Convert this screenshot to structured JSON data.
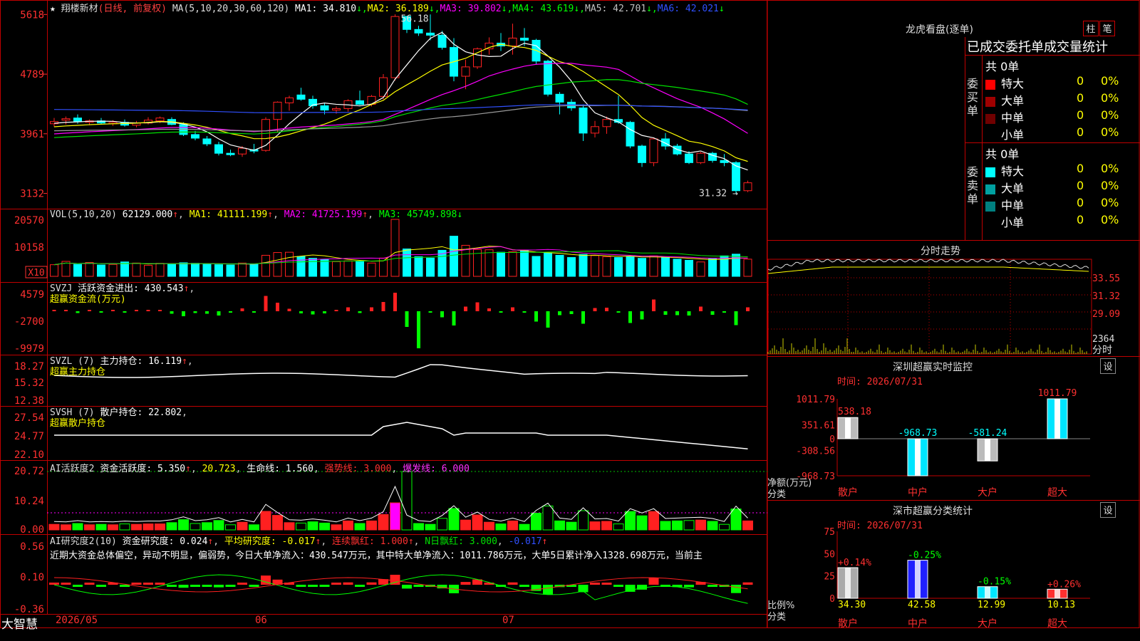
{
  "colors": {
    "up": "#ff2020",
    "down": "#00ffff",
    "grid": "#c00000",
    "white": "#ffffff",
    "yellow": "#ffff00",
    "magenta": "#ff00ff",
    "green": "#00e000",
    "gray": "#9a9a9a",
    "blue": "#3050ff",
    "lime": "#00ff00"
  },
  "header": {
    "stock_name": "翔楼新材",
    "mode": "(日线, 前复权)",
    "ma_params": "MA(5,10,20,30,60,120)",
    "mas": [
      {
        "label": "MA1: 34.810",
        "arrow": "↓",
        "color": "#ffffff"
      },
      {
        "label": "MA2: 36.189",
        "arrow": "↓",
        "color": "#ffff00"
      },
      {
        "label": "MA3: 39.802",
        "arrow": "↓",
        "color": "#ff00ff"
      },
      {
        "label": "MA4: 43.619",
        "arrow": "↓",
        "color": "#00ff00"
      },
      {
        "label": "MA5: 42.701",
        "arrow": "↓",
        "color": "#c0c0c0"
      },
      {
        "label": "MA6: 42.021",
        "arrow": "↓",
        "color": "#3050ff"
      }
    ]
  },
  "price_axis": [
    "5618",
    "4789",
    "3961",
    "3132"
  ],
  "annotations": {
    "high": "56.18",
    "low": "31.32"
  },
  "vol": {
    "title": "VOL(5,10,20)",
    "value": "62129.000",
    "ma1": "MA1: 41111.199",
    "ma2": "MA2: 41725.199",
    "ma3": "MA3: 45749.898",
    "axis": [
      "20570",
      "10158"
    ],
    "unit": "X10"
  },
  "svzj": {
    "title": "SVZJ",
    "label": "活跃资金进出: 430.543",
    "sub": "超赢资金流(万元)",
    "axis": [
      "4579",
      "-2700",
      "-9979"
    ]
  },
  "svzl": {
    "title": "SVZL (7)",
    "label": "主力持仓: 16.119",
    "sub": "超赢主力持仓",
    "axis": [
      "18.27",
      "15.32",
      "12.38"
    ]
  },
  "svsh": {
    "title": "SVSH (7)",
    "label": "散户持仓: 22.802",
    "sub": "超赢散户持仓",
    "axis": [
      "27.54",
      "24.77",
      "22.10"
    ]
  },
  "ai_active": {
    "title": "AI活跃度2",
    "label": "资金活跃度: 5.350",
    "v2": "20.723",
    "life": "生命线: 1.560",
    "strong": "强势线: 3.000",
    "burst": "爆发线: 6.000",
    "axis": [
      "20.72",
      "10.24",
      "0.00"
    ]
  },
  "ai_research": {
    "title": "AI研究度2(10)",
    "label": "资金研究度: 0.024",
    "avg": "平均研究度: -0.017",
    "red": "连续飘红: 1.000",
    "nday": "N日飘红: 3.000",
    "last": "-0.017",
    "axis": [
      "0.56",
      "0.10",
      "-0.36"
    ],
    "text": "近期大资金总体偏空，异动不明显，偏弱势，今日大单净流入：430.547万元，其中特大单净流入：1011.786万元，大单5日累计净入1328.698万元，当前主"
  },
  "date_axis": {
    "brand": "大智慧",
    "labels": [
      "2026/05",
      "06",
      "07"
    ]
  },
  "dragon": {
    "title": "龙虎看盘(逐单)",
    "btn1": "柱",
    "btn2": "笔",
    "tabs": "已成交委托单成交量统计",
    "buy_title": "委买单",
    "sell_title": "委卖单",
    "total_buy": "共 0单",
    "total_sell": "共 0单",
    "rows_buy": [
      {
        "name": "特大",
        "val": "0",
        "pct": "0%",
        "color": "#ff0000"
      },
      {
        "name": "大单",
        "val": "0",
        "pct": "0%",
        "color": "#a00000"
      },
      {
        "name": "中单",
        "val": "0",
        "pct": "0%",
        "color": "#700000"
      },
      {
        "name": "小单",
        "val": "0",
        "pct": "0%",
        "color": "#000000"
      }
    ],
    "rows_sell": [
      {
        "name": "特大",
        "val": "0",
        "pct": "0%",
        "color": "#00ffff"
      },
      {
        "name": "大单",
        "val": "0",
        "pct": "0%",
        "color": "#00a0a0"
      },
      {
        "name": "中单",
        "val": "0",
        "pct": "0%",
        "color": "#008080"
      },
      {
        "name": "小单",
        "val": "0",
        "pct": "0%",
        "color": "#000000"
      }
    ]
  },
  "intraday": {
    "title": "分时走势",
    "axis": [
      "33.55",
      "31.32",
      "29.09",
      "2364"
    ],
    "suffix": "分时"
  },
  "monitor": {
    "title": "深圳超赢实时监控",
    "set": "设",
    "time": "时间: 2026/07/31",
    "ylabel": "净额(万元)",
    "xlabel": "分类",
    "axis": [
      "1011.79",
      "351.61",
      "0",
      "-308.56",
      "-968.73"
    ],
    "bars": [
      {
        "name": "散户",
        "value": 538.18,
        "label": "538.18"
      },
      {
        "name": "中户",
        "value": -968.73,
        "label": "-968.73"
      },
      {
        "name": "大户",
        "value": -581.24,
        "label": "-581.24"
      },
      {
        "name": "超大",
        "value": 1011.79,
        "label": "1011.79"
      }
    ]
  },
  "classify": {
    "title": "深市超赢分类统计",
    "set": "设",
    "time": "时间: 2026/07/31",
    "ylabel": "比例%",
    "xlabel": "分类",
    "axis": [
      "75",
      "50",
      "25",
      "0"
    ],
    "bars": [
      {
        "name": "散户",
        "value": 34.3,
        "label": "34.30",
        "delta": "+0.14%"
      },
      {
        "name": "中户",
        "value": 42.58,
        "label": "42.58",
        "delta": "-0.25%"
      },
      {
        "name": "大户",
        "value": 12.99,
        "label": "12.99",
        "delta": "-0.15%"
      },
      {
        "name": "超大",
        "value": 10.13,
        "label": "10.13",
        "delta": "+0.26%"
      }
    ]
  },
  "chart_data": {
    "type": "candlestick",
    "title": "翔楼新材 (日线, 前复权)",
    "ylim": [
      31.32,
      56.18
    ],
    "ohlc": [
      [
        41.0,
        41.8,
        40.6,
        41.3
      ],
      [
        41.5,
        42.0,
        40.9,
        41.7
      ],
      [
        41.8,
        42.3,
        41.0,
        41.3
      ],
      [
        41.2,
        41.6,
        40.8,
        41.4
      ],
      [
        41.4,
        41.8,
        40.9,
        41.1
      ],
      [
        41.0,
        41.5,
        40.7,
        41.2
      ],
      [
        41.2,
        41.6,
        40.6,
        40.8
      ],
      [
        40.8,
        41.4,
        40.5,
        41.1
      ],
      [
        41.1,
        41.9,
        40.9,
        41.5
      ],
      [
        41.4,
        42.0,
        41.1,
        41.8
      ],
      [
        41.6,
        41.9,
        40.8,
        40.9
      ],
      [
        40.9,
        41.2,
        39.3,
        39.5
      ],
      [
        39.5,
        40.0,
        38.7,
        39.0
      ],
      [
        38.9,
        39.3,
        37.9,
        38.2
      ],
      [
        38.1,
        38.5,
        36.6,
        36.9
      ],
      [
        36.9,
        37.4,
        36.5,
        36.7
      ],
      [
        36.8,
        37.9,
        36.4,
        37.6
      ],
      [
        37.4,
        38.2,
        36.9,
        37.2
      ],
      [
        37.3,
        41.9,
        37.1,
        41.6
      ],
      [
        41.6,
        44.1,
        39.8,
        44.0
      ],
      [
        43.9,
        44.9,
        42.8,
        44.6
      ],
      [
        45.0,
        46.0,
        44.2,
        44.4
      ],
      [
        44.4,
        44.9,
        43.1,
        43.5
      ],
      [
        43.5,
        43.9,
        42.3,
        42.9
      ],
      [
        42.9,
        43.4,
        42.4,
        43.1
      ],
      [
        43.1,
        44.4,
        42.7,
        44.2
      ],
      [
        44.2,
        45.6,
        43.6,
        43.7
      ],
      [
        43.7,
        45.0,
        43.4,
        44.8
      ],
      [
        44.8,
        47.9,
        44.4,
        47.4
      ],
      [
        47.4,
        56.2,
        47.0,
        55.9
      ],
      [
        55.9,
        56.0,
        53.6,
        54.1
      ],
      [
        54.1,
        54.6,
        53.2,
        53.6
      ],
      [
        53.6,
        56.18,
        52.6,
        53.3
      ],
      [
        53.3,
        53.9,
        51.3,
        51.6
      ],
      [
        51.6,
        52.9,
        46.9,
        47.6
      ],
      [
        47.6,
        49.9,
        45.8,
        48.9
      ],
      [
        48.9,
        51.6,
        48.6,
        51.4
      ],
      [
        51.4,
        53.0,
        50.6,
        52.2
      ],
      [
        52.2,
        53.6,
        51.1,
        51.8
      ],
      [
        51.8,
        54.9,
        50.6,
        52.9
      ],
      [
        52.9,
        54.3,
        51.8,
        52.6
      ],
      [
        52.6,
        52.8,
        49.2,
        49.7
      ],
      [
        49.7,
        49.9,
        44.8,
        45.1
      ],
      [
        45.1,
        45.4,
        42.3,
        44.0
      ],
      [
        44.0,
        44.4,
        42.8,
        43.2
      ],
      [
        43.2,
        43.7,
        38.6,
        39.7
      ],
      [
        39.7,
        41.4,
        39.1,
        40.6
      ],
      [
        40.6,
        42.0,
        39.6,
        41.6
      ],
      [
        41.6,
        44.9,
        41.0,
        41.2
      ],
      [
        41.2,
        41.4,
        37.6,
        37.9
      ],
      [
        37.9,
        38.1,
        35.0,
        35.6
      ],
      [
        35.6,
        39.1,
        35.1,
        38.9
      ],
      [
        38.9,
        39.7,
        37.4,
        37.9
      ],
      [
        37.9,
        38.2,
        36.6,
        36.8
      ],
      [
        36.8,
        37.2,
        35.4,
        35.6
      ],
      [
        35.6,
        37.1,
        35.4,
        36.9
      ],
      [
        36.9,
        37.1,
        35.6,
        35.9
      ],
      [
        35.9,
        36.8,
        35.1,
        35.6
      ],
      [
        35.6,
        35.8,
        31.32,
        31.7
      ],
      [
        31.7,
        33.1,
        31.5,
        32.8
      ]
    ],
    "volume": [
      4200,
      5400,
      4300,
      5000,
      4100,
      4300,
      5200,
      4800,
      4000,
      4700,
      4300,
      4900,
      4700,
      4500,
      4200,
      4100,
      4800,
      4400,
      7600,
      8600,
      8700,
      7200,
      6500,
      6100,
      5300,
      5600,
      5500,
      4800,
      6600,
      20570,
      9900,
      7100,
      6600,
      9400,
      14500,
      11200,
      9700,
      9600,
      8700,
      8900,
      9500,
      7200,
      8400,
      7600,
      6800,
      7900,
      7500,
      7100,
      6800,
      7200,
      6500,
      7400,
      6700,
      6200,
      5800,
      5200,
      6300,
      7400,
      8000,
      6200
    ],
    "vol_ma": {
      "MA1": 41111.199,
      "MA2": 41725.199,
      "MA3": 45749.898
    }
  }
}
